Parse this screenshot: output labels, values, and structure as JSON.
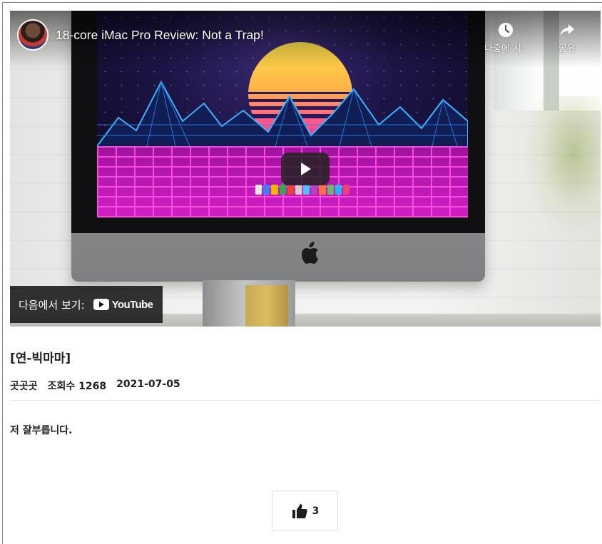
{
  "video": {
    "title": "18-core iMac Pro Review: Not a Trap!",
    "watch_later_label": "나중에 시...",
    "share_label": "공유",
    "watch_on_label": "다음에서 보기:",
    "youtube_logo_text": "YouTube"
  },
  "post": {
    "title": "[연-빅마마]",
    "author": "곳곳곳",
    "views": "조회수 1268",
    "date": "2021-07-05",
    "body": "저 잘부릅니다."
  },
  "like": {
    "count": "3"
  },
  "colors": {
    "overlay": "#171717",
    "text": "#222222",
    "divider": "#e3e3e3"
  }
}
